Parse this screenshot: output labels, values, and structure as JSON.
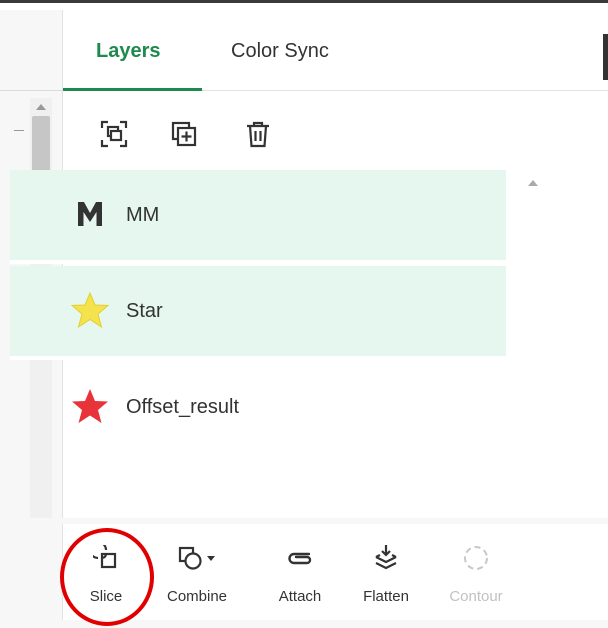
{
  "tabs": [
    {
      "label": "Layers",
      "active": true
    },
    {
      "label": "Color Sync",
      "active": false
    }
  ],
  "toolbar": {
    "icons": [
      "group-icon",
      "duplicate-icon",
      "delete-icon"
    ]
  },
  "layers": [
    {
      "name": "MM",
      "icon": "letter-m-icon",
      "selected": true,
      "color": "#333333"
    },
    {
      "name": "Star",
      "icon": "yellow-star-icon",
      "selected": true,
      "color": "#f5e34d"
    },
    {
      "name": "Offset_result",
      "icon": "red-star-icon",
      "selected": false,
      "color": "#e8333a"
    }
  ],
  "bottom_tools": [
    {
      "label": "Slice",
      "icon": "slice-icon",
      "enabled": true
    },
    {
      "label": "Combine",
      "icon": "combine-icon",
      "enabled": true
    },
    {
      "label": "Attach",
      "icon": "attach-icon",
      "enabled": true
    },
    {
      "label": "Flatten",
      "icon": "flatten-icon",
      "enabled": true
    },
    {
      "label": "Contour",
      "icon": "contour-icon",
      "enabled": false
    }
  ],
  "colors": {
    "accent": "#1e8a4d",
    "selected_row": "#e6f7f0",
    "highlight_circle": "#e00000"
  }
}
